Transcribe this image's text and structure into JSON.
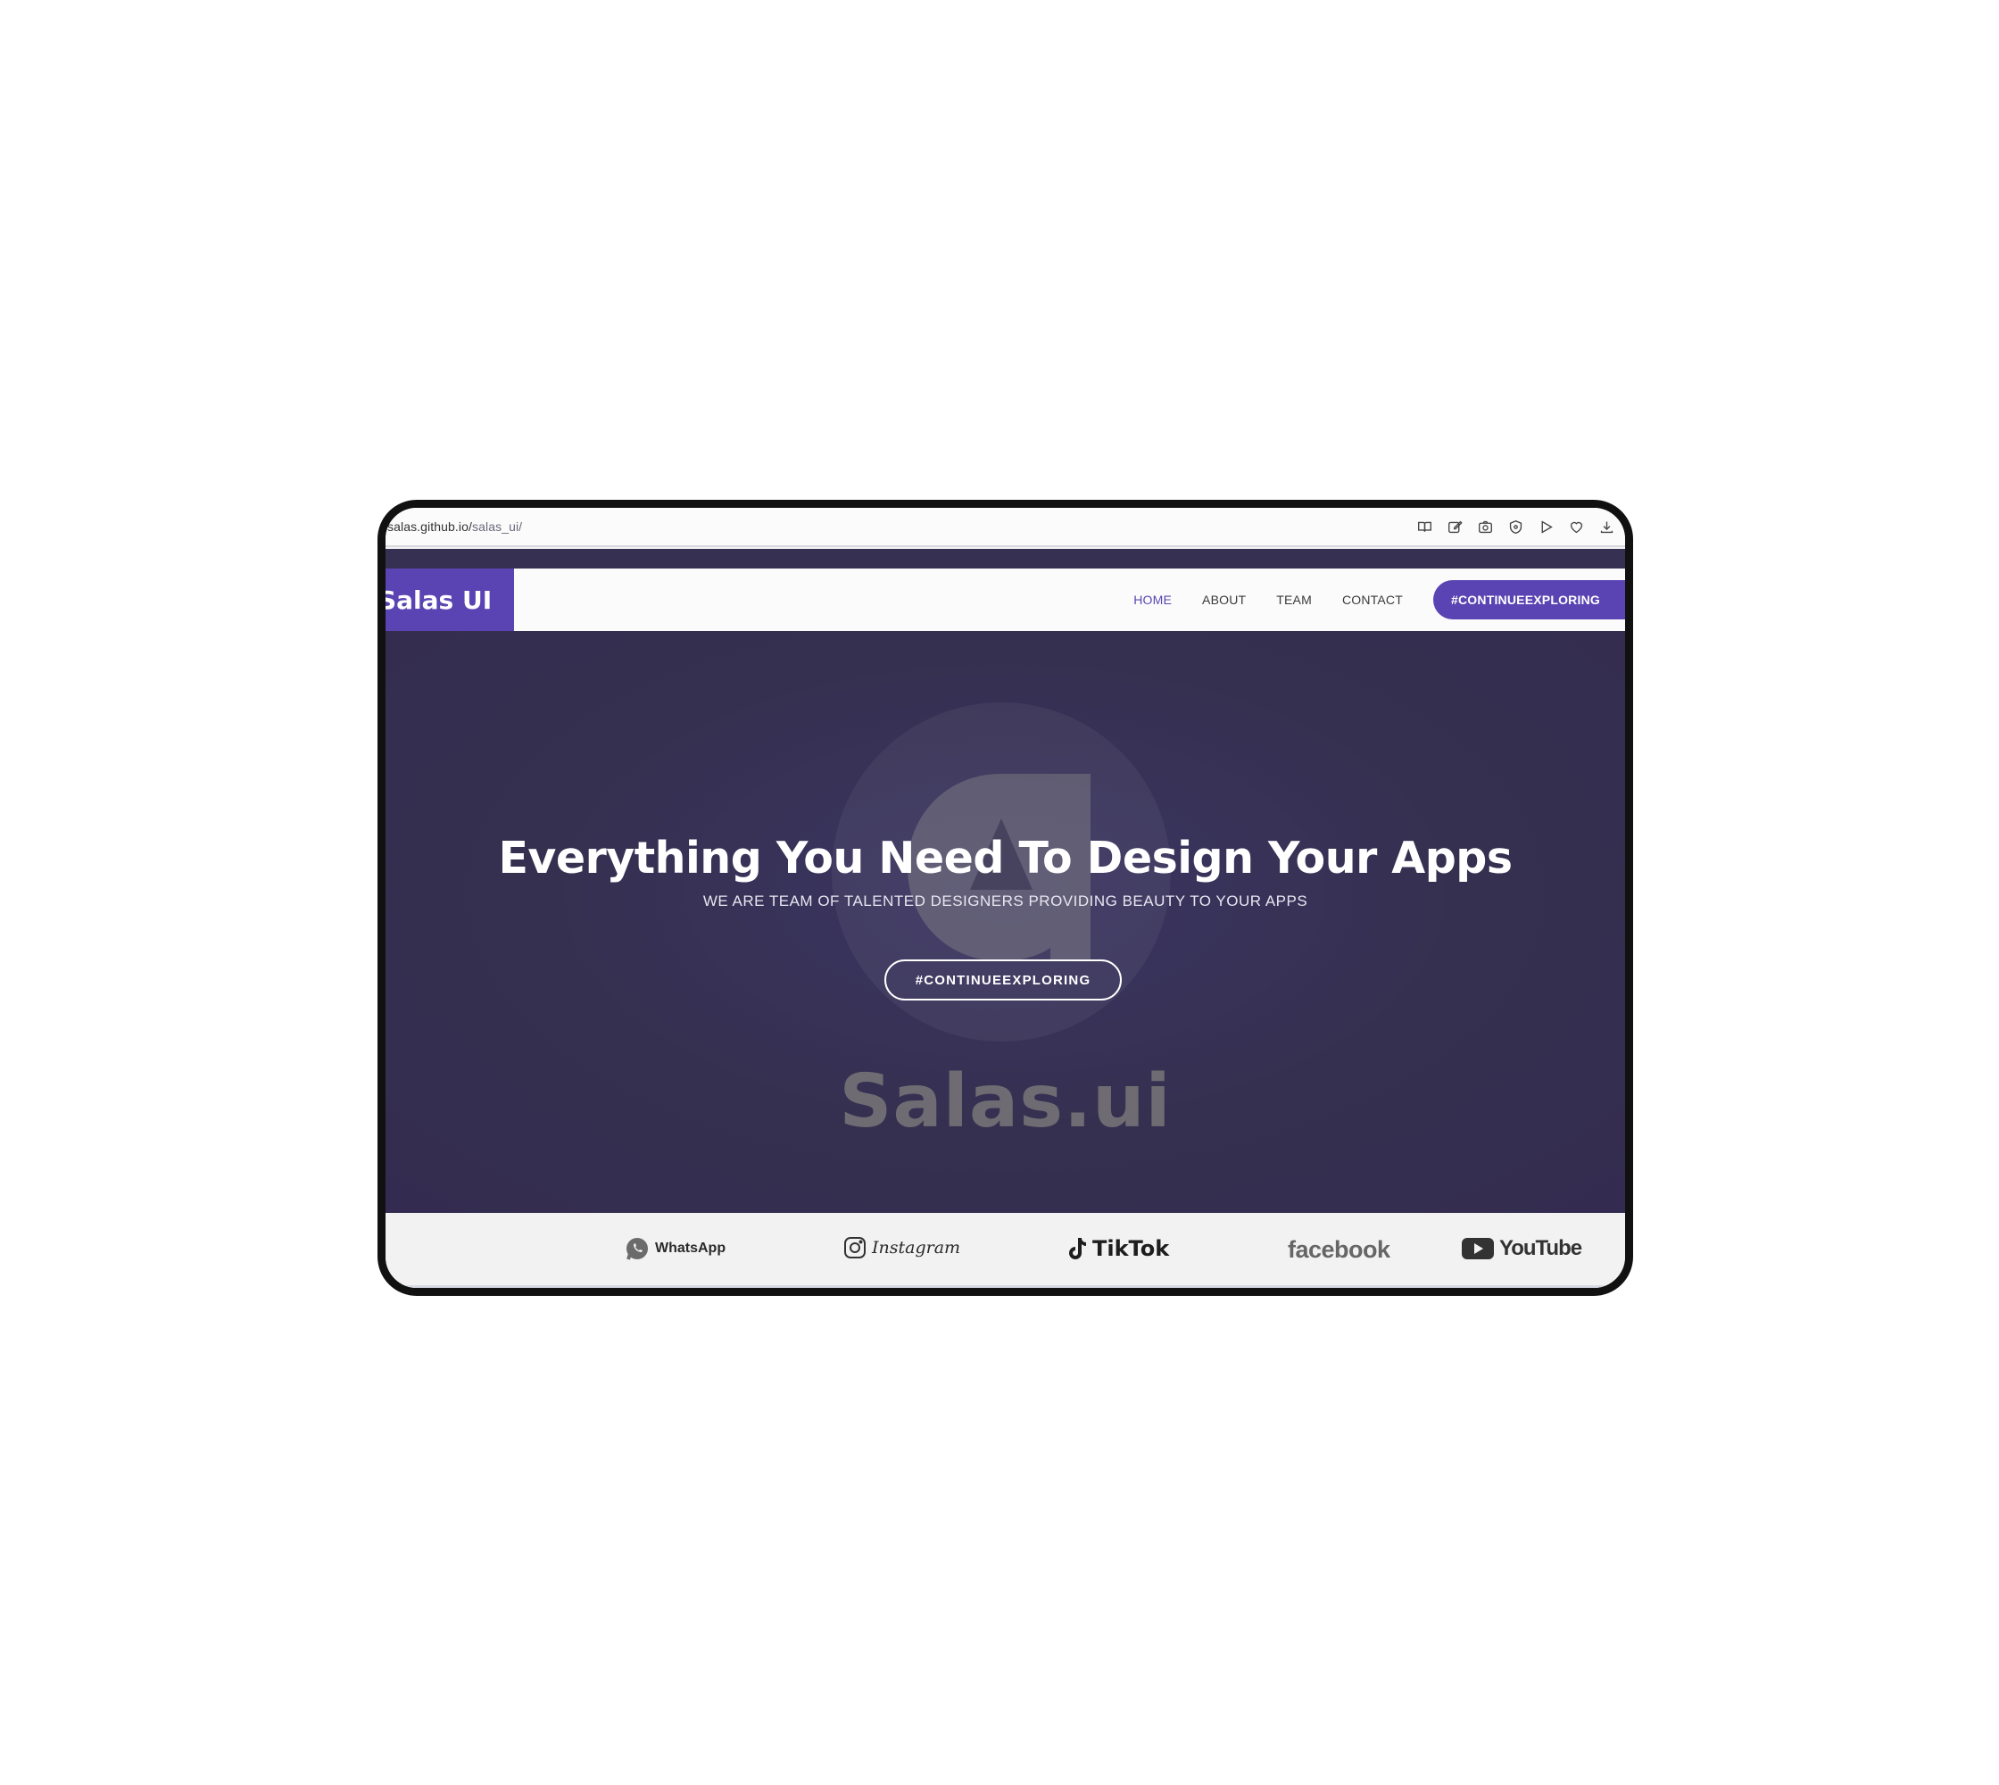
{
  "browser": {
    "url_host": "salas.github.io/",
    "url_path": "salas_ui/",
    "toolbar_icons": [
      "reader-icon",
      "edit-icon",
      "camera-icon",
      "shield-icon",
      "play-icon",
      "heart-icon",
      "download-icon"
    ]
  },
  "navbar": {
    "brand": "Salas UI",
    "links": [
      {
        "label": "HOME",
        "active": true
      },
      {
        "label": "ABOUT",
        "active": false
      },
      {
        "label": "TEAM",
        "active": false
      },
      {
        "label": "CONTACT",
        "active": false
      }
    ],
    "cta_label": "#CONTINUEEXPLORING"
  },
  "hero": {
    "title": "Everything You Need To Design Your Apps",
    "subtitle": "WE ARE TEAM OF TALENTED DESIGNERS PROVIDING BEAUTY TO YOUR APPS",
    "button_label": "#CONTINUEEXPLORING",
    "wordmark": "Salas.ui"
  },
  "brands": {
    "whatsapp": "WhatsApp",
    "instagram": "Instagram",
    "tiktok": "TikTok",
    "facebook": "facebook",
    "youtube": "YouTube"
  },
  "colors": {
    "accent": "#5a44b3",
    "hero_bg": "#35304f",
    "frame": "#111111"
  }
}
